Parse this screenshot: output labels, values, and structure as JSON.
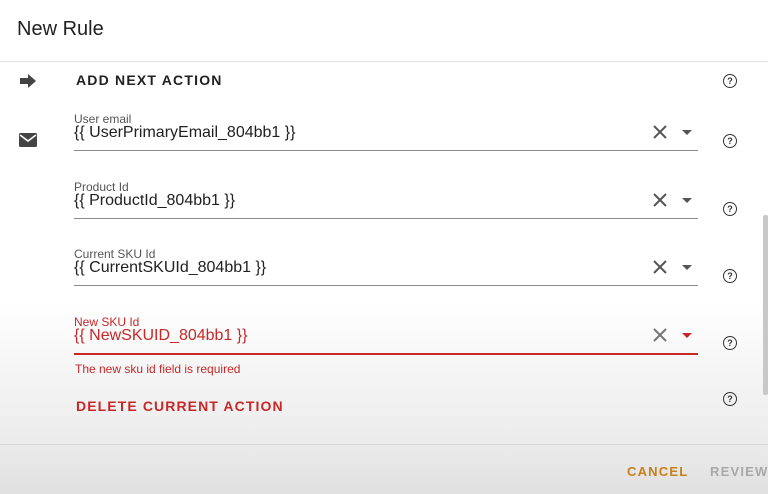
{
  "dialog": {
    "title": "New Rule",
    "add_next_action": "ADD NEXT ACTION",
    "action_icon": "email-icon",
    "fields": [
      {
        "label": "User email",
        "value": "{{ UserPrimaryEmail_804bb1 }}"
      },
      {
        "label": "Product Id",
        "value": "{{ ProductId_804bb1 }}"
      },
      {
        "label": "Current SKU Id",
        "value": "{{ CurrentSKUId_804bb1 }}"
      },
      {
        "label": "New SKU Id",
        "value": "{{ NewSKUID_804bb1 }}",
        "error": "The new sku id field is required"
      }
    ],
    "help_glyph": "?",
    "delete_action": "DELETE CURRENT ACTION"
  },
  "footer": {
    "cancel": "CANCEL",
    "review": "REVIEW"
  },
  "colors": {
    "error": "#c62828",
    "accent": "#c77f1a",
    "disabled": "#a8a8a8"
  }
}
